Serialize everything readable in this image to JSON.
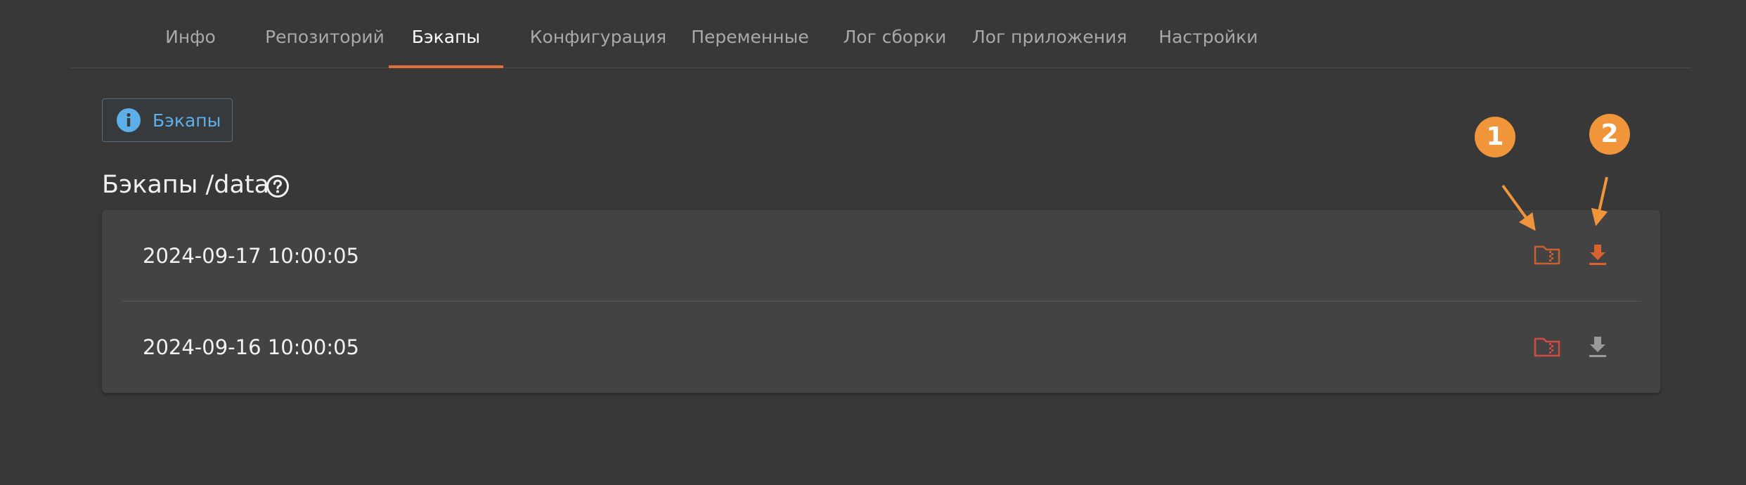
{
  "tabs": [
    {
      "label": "Инфо",
      "active": false
    },
    {
      "label": "Репозиторий",
      "active": false
    },
    {
      "label": "Бэкапы",
      "active": true
    },
    {
      "label": "Конфигурация",
      "active": false
    },
    {
      "label": "Переменные",
      "active": false
    },
    {
      "label": "Лог сборки",
      "active": false
    },
    {
      "label": "Лог приложения",
      "active": false
    },
    {
      "label": "Настройки",
      "active": false
    }
  ],
  "info_chip": {
    "label": "Бэкапы",
    "icon": "info-icon"
  },
  "section": {
    "title": "Бэкапы /data",
    "help_icon": "help-circle-icon"
  },
  "backups": [
    {
      "date": "2024-09-17 10:00:05",
      "restore_icon": "folder-zip-icon",
      "download_icon": "download-icon",
      "highlighted": true
    },
    {
      "date": "2024-09-16 10:00:05",
      "restore_icon": "folder-zip-icon",
      "download_icon": "download-icon",
      "highlighted": false
    }
  ],
  "annotations": [
    {
      "label": "1"
    },
    {
      "label": "2"
    }
  ],
  "colors": {
    "background": "#383838",
    "card": "#434343",
    "accent": "#e0703a",
    "annotation": "#f0953a",
    "info": "#5eaee8",
    "folder_active": "#c8612e",
    "folder_inactive": "#d24a44",
    "download_active": "#d9622f",
    "download_inactive": "#9a9a9a"
  }
}
